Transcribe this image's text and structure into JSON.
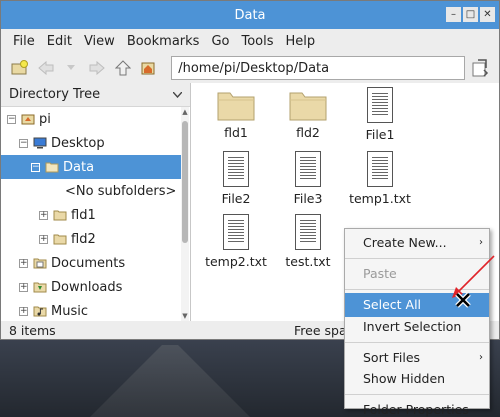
{
  "window": {
    "title": "Data",
    "controls": [
      "–",
      "□",
      "✕"
    ]
  },
  "menubar": [
    "File",
    "Edit",
    "View",
    "Bookmarks",
    "Go",
    "Tools",
    "Help"
  ],
  "toolbar": {
    "path": "/home/pi/Desktop/Data"
  },
  "sidebar": {
    "header": "Directory Tree",
    "items": [
      {
        "label": "pi",
        "expander": "−"
      },
      {
        "label": "Desktop",
        "expander": "−"
      },
      {
        "label": "Data",
        "expander": "−"
      },
      {
        "label": "<No subfolders>",
        "expander": ""
      },
      {
        "label": "fld1",
        "expander": "+"
      },
      {
        "label": "fld2",
        "expander": "+"
      },
      {
        "label": "Documents",
        "expander": "+"
      },
      {
        "label": "Downloads",
        "expander": "+"
      },
      {
        "label": "Music",
        "expander": "+"
      }
    ]
  },
  "files": [
    {
      "name": "fld1",
      "type": "folder"
    },
    {
      "name": "fld2",
      "type": "folder"
    },
    {
      "name": "File1",
      "type": "file"
    },
    {
      "name": "File2",
      "type": "file"
    },
    {
      "name": "File3",
      "type": "file"
    },
    {
      "name": "temp1.txt",
      "type": "file"
    },
    {
      "name": "temp2.txt",
      "type": "file"
    },
    {
      "name": "test.txt",
      "type": "file"
    }
  ],
  "status": {
    "items": "8 items",
    "free": "Free spac"
  },
  "context_menu": {
    "items": [
      {
        "label": "Create New...",
        "state": "normal",
        "submenu": "›"
      },
      {
        "label": "Paste",
        "state": "disabled"
      },
      {
        "label": "Select All",
        "state": "highlight"
      },
      {
        "label": "Invert Selection",
        "state": "normal"
      },
      {
        "label": "Sort Files",
        "state": "normal",
        "submenu": "›"
      },
      {
        "label": "Show Hidden",
        "state": "normal"
      },
      {
        "label": "Folder Properties",
        "state": "normal"
      }
    ]
  },
  "colors": {
    "accent": "#4d93d6",
    "folder": "#ead9a8",
    "annotation": "#e0242a"
  }
}
